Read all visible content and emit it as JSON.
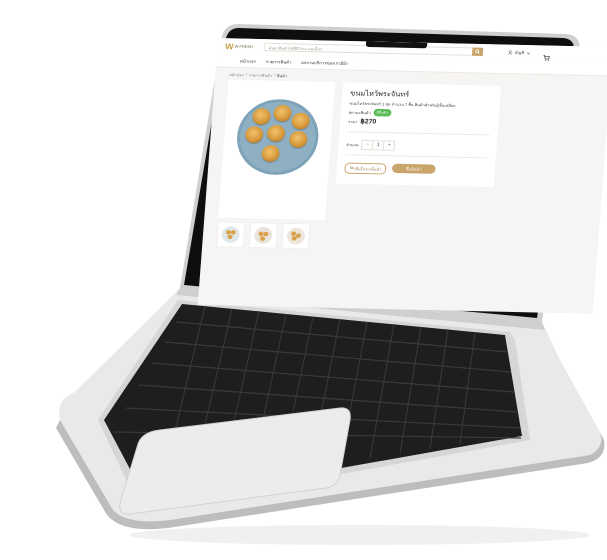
{
  "header": {
    "logo_text": "W FRESH",
    "search_placeholder": "ค้นหาสินค้าได้ที่นี่ ร้าน และอื่นๆ",
    "account_label": "บัญชี"
  },
  "nav": {
    "items": [
      "หน้าแรก",
      "รายการสินค้า",
      "ผลงานบริการของเรามีผ้า"
    ]
  },
  "breadcrumb": {
    "home": "หน้าแรก",
    "sep1": "/",
    "category": "รายการสินค้า",
    "sep2": "/",
    "current": "สินค้า"
  },
  "product": {
    "title": "ขนมไหว้พระจันทร์",
    "description": "ขนมไหว้พระจันทร์ 1 ชุด จำนวน 7 ชิ้น สินค้าสำหรับผู้ชั้นเหมือก",
    "stock_label": "สถานะสินค้า",
    "stock_status": "มีสินค้า",
    "price_label": "ราคา",
    "price": "฿270",
    "qty_label": "จำนวน",
    "qty_minus": "−",
    "qty_value": "1",
    "qty_plus": "+",
    "add_to_cart": "เพิ่มในรถเข็นช้า",
    "buy_now": "ซื้อสินค้า"
  },
  "colors": {
    "accent": "#c9a46b",
    "in_stock": "#5bbd57"
  }
}
